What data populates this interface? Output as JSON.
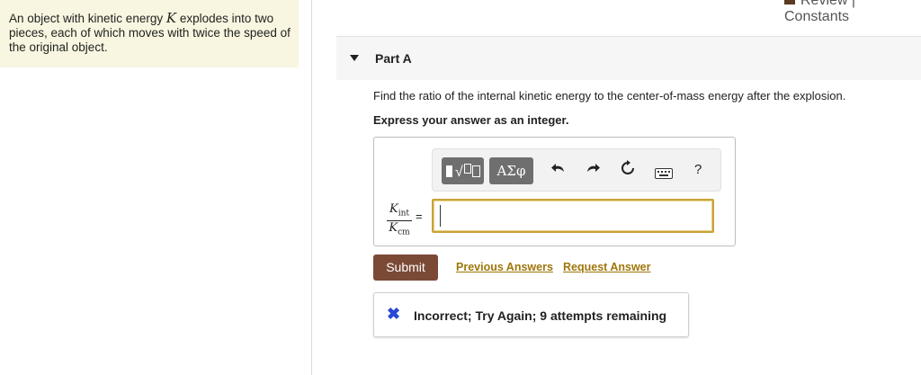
{
  "problem": {
    "text_before": "An object with kinetic energy ",
    "symbol": "K",
    "text_after": " explodes into two pieces, each of which moves with twice the speed of the original object."
  },
  "header": {
    "review_constants": "Review | Constants"
  },
  "part": {
    "title": "Part A"
  },
  "question": "Find the ratio of the internal kinetic energy to the center-of-mass energy after the explosion.",
  "instruction": "Express your answer as an integer.",
  "toolbar": {
    "greek_label": "ΑΣφ",
    "undo_icon": "undo-arrow-icon",
    "redo_icon": "redo-arrow-icon",
    "reset_icon": "reset-icon",
    "keyboard_icon": "keyboard-icon",
    "help_label": "?"
  },
  "answer": {
    "lhs_num_main": "K",
    "lhs_num_sub": "int",
    "lhs_den_main": "K",
    "lhs_den_sub": "cm",
    "equals": "=",
    "value": ""
  },
  "actions": {
    "submit_label": "Submit",
    "previous_answers_label": "Previous Answers",
    "request_answer_label": "Request Answer"
  },
  "feedback": {
    "icon": "✖",
    "message": "Incorrect; Try Again; 9 attempts remaining",
    "icon_color": "#2747d6"
  },
  "colors": {
    "accent_link": "#a0760a",
    "submit_bg": "#7b4a37",
    "panel_bg": "#f8f6e0"
  }
}
